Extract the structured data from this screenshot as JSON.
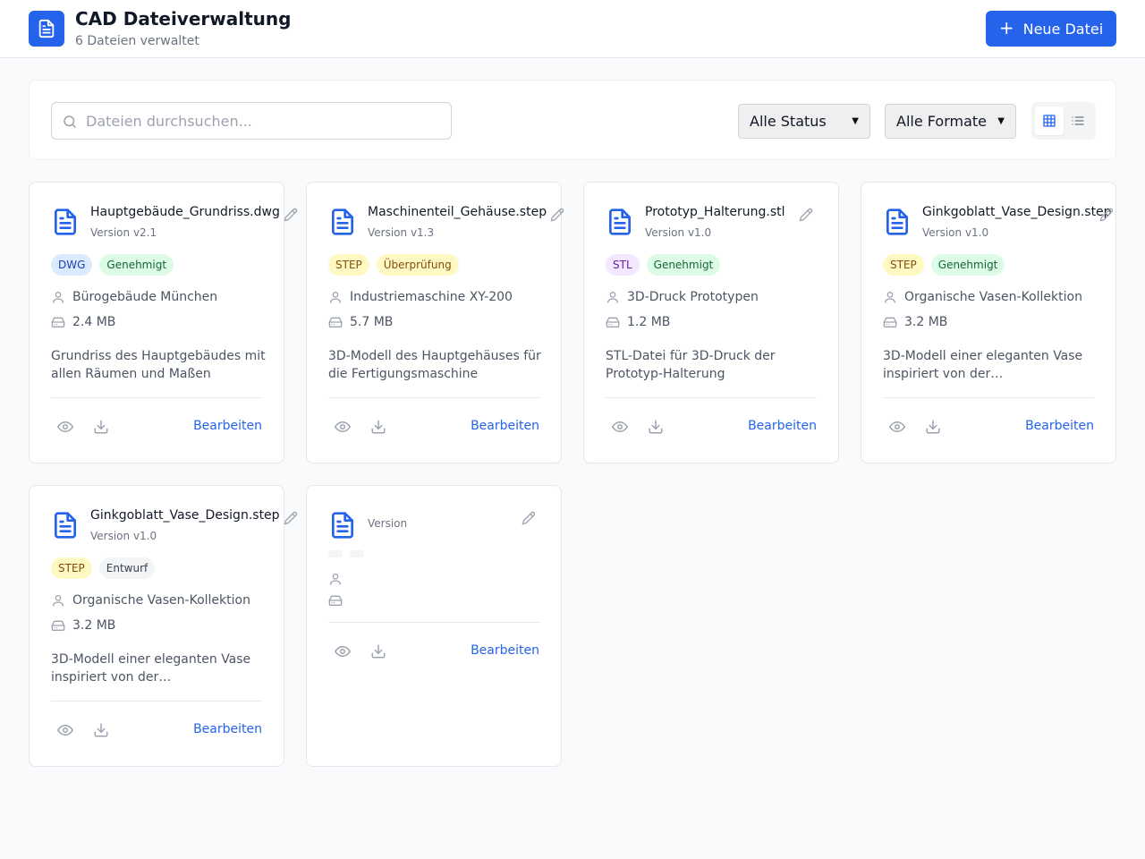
{
  "header": {
    "title": "CAD Dateiverwaltung",
    "subtitle": "6 Dateien verwaltet",
    "new_button_label": "Neue Datei"
  },
  "toolbar": {
    "search_placeholder": "Dateien durchsuchen...",
    "status_filter": "Alle Status",
    "format_filter": "Alle Formate",
    "view_mode": "grid"
  },
  "colors": {
    "accent": "#2563eb",
    "badge_dwg_bg": "#dbeafe",
    "badge_dwg_fg": "#1e40af",
    "badge_step_bg": "#fef9c3",
    "badge_step_fg": "#854d0e",
    "badge_stl_bg": "#f3e8ff",
    "badge_stl_fg": "#6b21a8",
    "status_approved_bg": "#dcfce7",
    "status_approved_fg": "#166534",
    "status_review_bg": "#fef9c3",
    "status_review_fg": "#854d0e",
    "status_draft_bg": "#f3f4f6",
    "status_draft_fg": "#374151"
  },
  "cards": [
    {
      "name": "Hauptgebäude_Grundriss.dwg",
      "version": "Version v2.1",
      "format": "DWG",
      "status": "Genehmigt",
      "project": "Bürogebäude München",
      "size": "2.4 MB",
      "description": "Grundriss des Hauptgebäudes mit allen Räumen und Maßen",
      "edit_label": "Bearbeiten"
    },
    {
      "name": "Maschinenteil_Gehäuse.step",
      "version": "Version v1.3",
      "format": "STEP",
      "status": "Überprüfung",
      "project": "Industriemaschine XY-200",
      "size": "5.7 MB",
      "description": "3D-Modell des Hauptgehäuses für die Fertigungsmaschine",
      "edit_label": "Bearbeiten"
    },
    {
      "name": "Prototyp_Halterung.stl",
      "version": "Version v1.0",
      "format": "STL",
      "status": "Genehmigt",
      "project": "3D-Druck Prototypen",
      "size": "1.2 MB",
      "description": "STL-Datei für 3D-Druck der Prototyp-Halterung",
      "edit_label": "Bearbeiten"
    },
    {
      "name": "Ginkgoblatt_Vase_Design.step",
      "version": "Version v1.0",
      "format": "STEP",
      "status": "Genehmigt",
      "project": "Organische Vasen-Kollektion",
      "size": "3.2 MB",
      "description": "3D-Modell einer eleganten Vase inspiriert von der…",
      "edit_label": "Bearbeiten"
    },
    {
      "name": "Ginkgoblatt_Vase_Design.step",
      "version": "Version v1.0",
      "format": "STEP",
      "status": "Entwurf",
      "project": "Organische Vasen-Kollektion",
      "size": "3.2 MB",
      "description": "3D-Modell einer eleganten Vase inspiriert von der…",
      "edit_label": "Bearbeiten"
    },
    {
      "name": "",
      "version": "Version",
      "format": "",
      "status": "",
      "project": "",
      "size": "",
      "description": "",
      "edit_label": "Bearbeiten"
    }
  ]
}
